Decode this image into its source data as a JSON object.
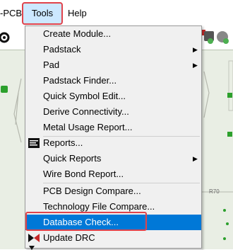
{
  "menubar": {
    "left_partial": "-PCB",
    "tools": "Tools",
    "help": "Help"
  },
  "tools_menu": {
    "items": [
      {
        "label": "Create Module..."
      },
      {
        "label": "Padstack",
        "submenu": true
      },
      {
        "label": "Pad",
        "submenu": true
      },
      {
        "label": "Padstack Finder..."
      },
      {
        "label": "Quick Symbol Edit..."
      },
      {
        "label": "Derive Connectivity..."
      },
      {
        "label": "Metal Usage Report..."
      },
      {
        "label": "Reports...",
        "icon": "reports-icon"
      },
      {
        "label": "Quick Reports",
        "submenu": true
      },
      {
        "label": "Wire Bond Report..."
      },
      {
        "label": "PCB Design Compare..."
      },
      {
        "label": "Technology File Compare..."
      },
      {
        "label": "Database Check...",
        "selected": true
      },
      {
        "label": "Update DRC",
        "icon": "update-drc-icon"
      }
    ]
  },
  "canvas": {
    "right_label": "R70"
  },
  "colors": {
    "selection": "#0078d7",
    "highlight_border": "#e0434b",
    "menu_bg": "#f0f0f0"
  }
}
